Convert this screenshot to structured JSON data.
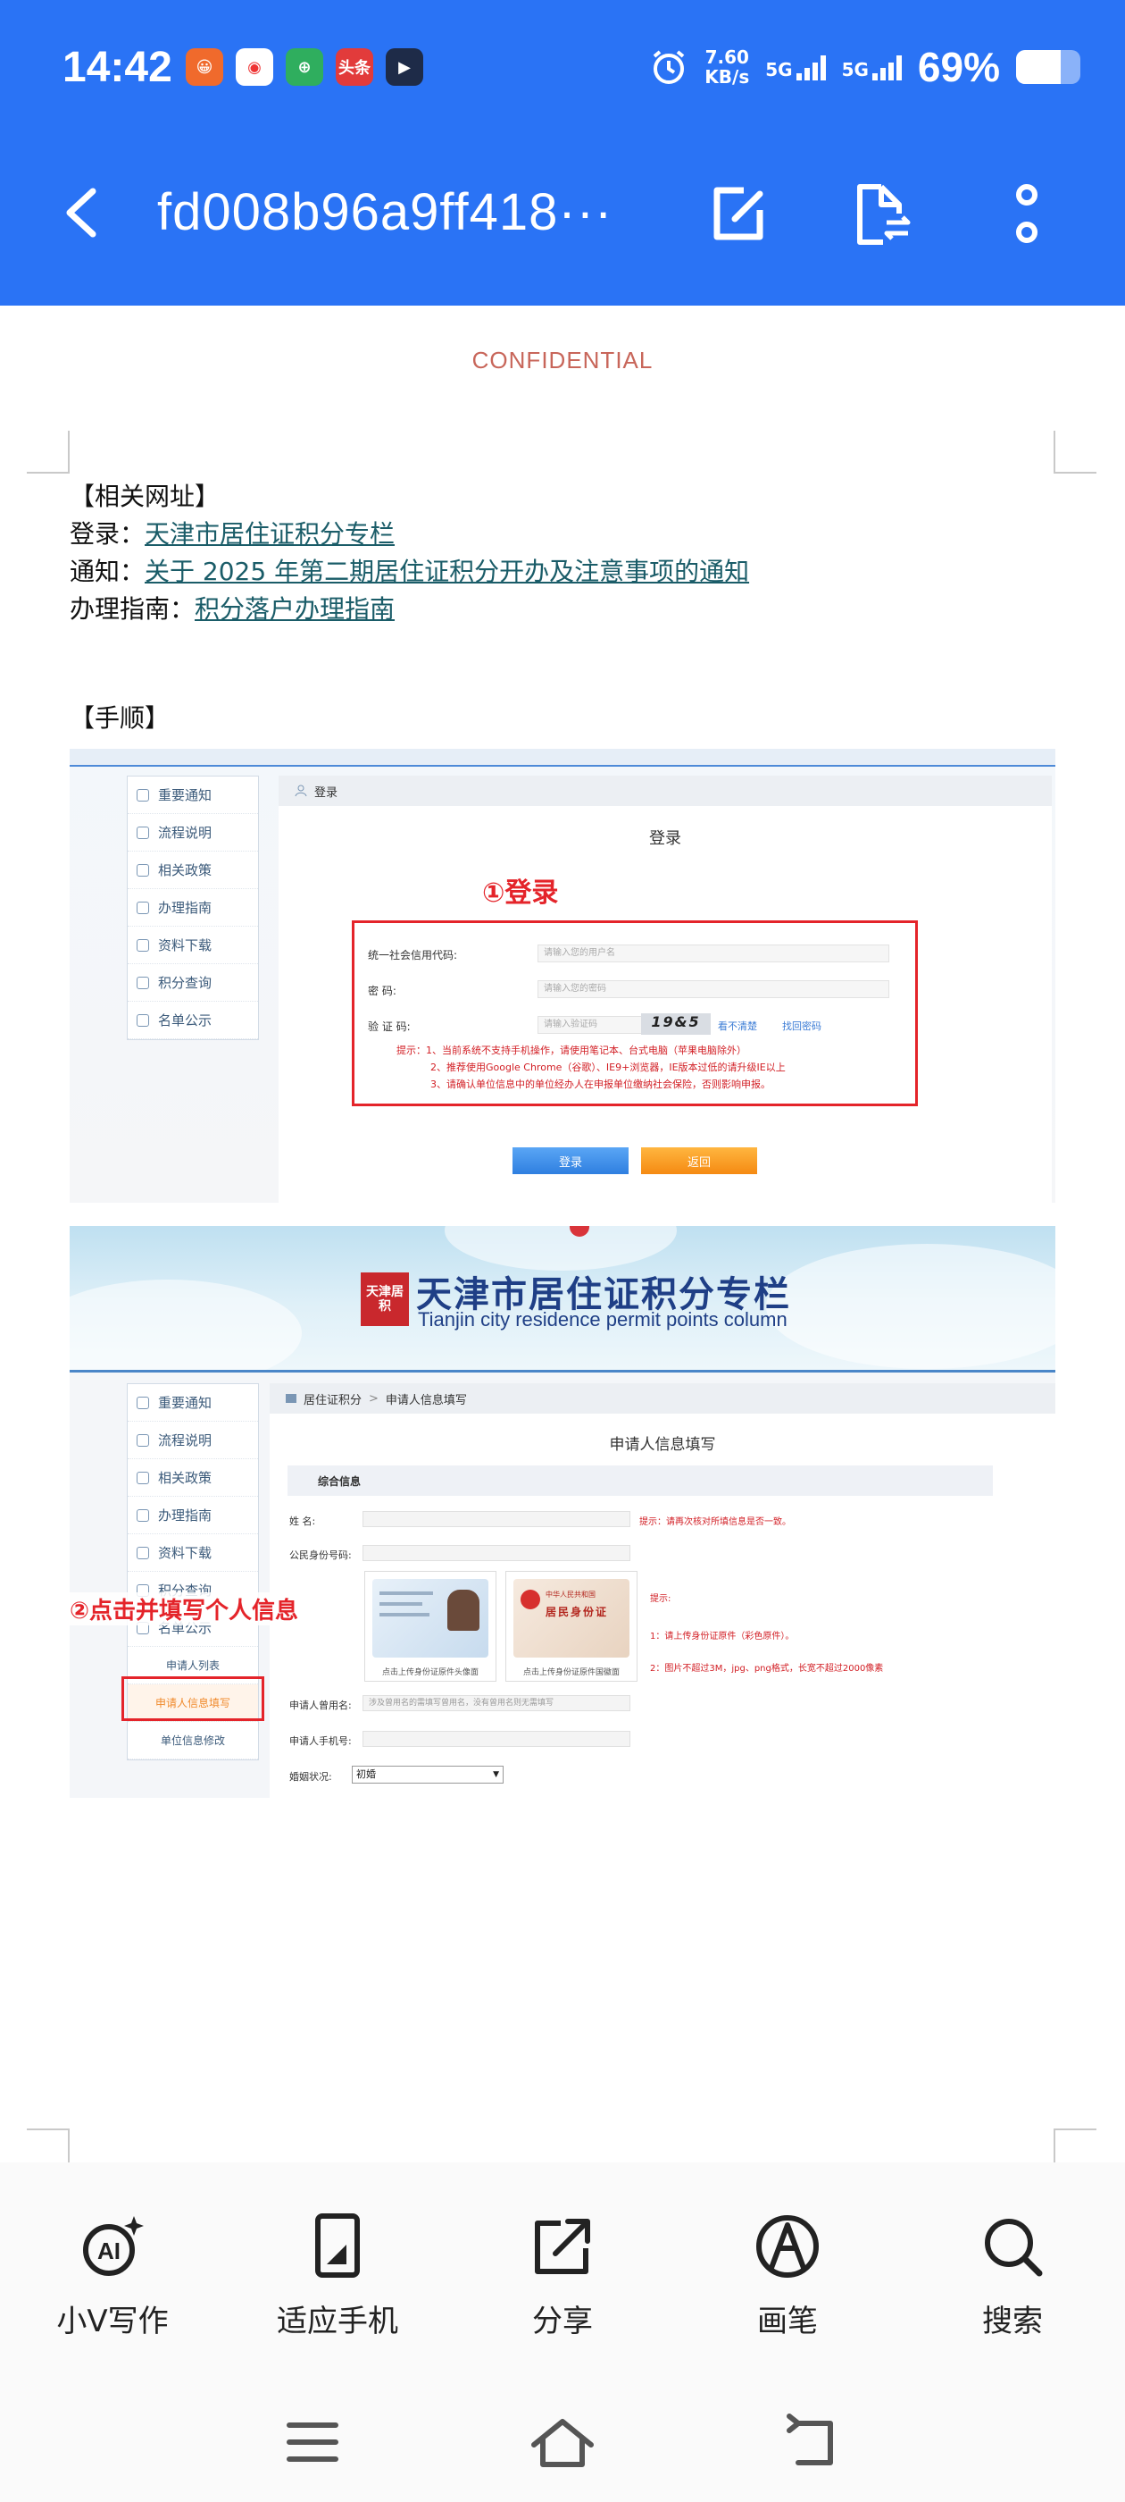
{
  "status_bar": {
    "time": "14:42",
    "apps": [
      {
        "name": "app-icon-1",
        "color": "#f06a2c",
        "glyph": "😀"
      },
      {
        "name": "app-icon-2",
        "color": "#ffffff",
        "glyph": "◉"
      },
      {
        "name": "app-icon-3",
        "color": "#2fae5e",
        "glyph": "⊕"
      },
      {
        "name": "toutiao-icon",
        "color": "#e23b3b",
        "glyph": "头条"
      },
      {
        "name": "app-icon-5",
        "color": "#1e2b48",
        "glyph": "▶"
      }
    ],
    "speed_value": "7.60",
    "speed_unit": "KB/s",
    "net1": "5G",
    "net2": "5G",
    "battery": "69%",
    "battery_level": 0.69
  },
  "nav": {
    "title": "fd008b96a9ff418···"
  },
  "doc": {
    "watermark": "CONFIDENTIAL",
    "links_heading": "【相关网址】",
    "line1_label": "登录：",
    "line1_link": "天津市居住证积分专栏",
    "line2_label": "通知：",
    "line2_link": "关于 2025 年第二期居住证积分开办及注意事项的通知",
    "line3_label": "办理指南：",
    "line3_link": "积分落户办理指南",
    "steps_heading": "【手顺】"
  },
  "shot1": {
    "menu": [
      "重要通知",
      "流程说明",
      "相关政策",
      "办理指南",
      "资料下载",
      "积分查询",
      "名单公示"
    ],
    "crumb": "登录",
    "panel_title": "登录",
    "annotation": "①登录",
    "fields": [
      {
        "label": "统一社会信用代码:",
        "placeholder": "请输入您的用户名"
      },
      {
        "label": "密      码:",
        "placeholder": "请输入您的密码"
      },
      {
        "label": "验  证  码:",
        "placeholder": "请输入验证码"
      }
    ],
    "captcha": "19&5",
    "captcha_link": "看不清楚",
    "forgot_link": "找回密码",
    "tips": [
      "提示：1、当前系统不支持手机操作，请使用笔记本、台式电脑（苹果电脑除外）",
      "2、推荐使用Google Chrome（谷歌）、IE9+浏览器，IE版本过低的请升级IE以上",
      "3、请确认单位信息中的单位经办人在申报单位缴纳社会保险，否则影响申报。"
    ],
    "btn_login": "登录",
    "btn_back": "返回"
  },
  "shot2": {
    "seal_text": "天津居积",
    "banner_cn": "天津市居住证积分专栏",
    "banner_en": "Tianjin city residence permit points column",
    "menu": [
      "重要通知",
      "流程说明",
      "相关政策",
      "办理指南",
      "资料下载",
      "积分查询",
      "名单公示"
    ],
    "submenu": [
      "申请人列表",
      "申请人信息填写",
      "单位信息修改"
    ],
    "crumb_home": "居住证积分",
    "crumb_sep": ">",
    "crumb_page": "申请人信息填写",
    "panel_title": "申请人信息填写",
    "section_title": "综合信息",
    "annotation": "②点击并填写个人信息",
    "name_label": "姓    名:",
    "name_tip": "提示：请再次核对所填信息是否一致。",
    "id_label": "公民身份号码:",
    "card1_caption": "点击上传身份证原件头像面",
    "card2_caption": "点击上传身份证原件国徽面",
    "card2_title": "中华人民共和国",
    "card2_subtitle": "居民身份证",
    "upload_tip_title": "提示:",
    "upload_tip1": "1：请上传身份证原件（彩色原件）。",
    "upload_tip2": "2：图片不超过3M，jpg、png格式，长宽不超过2000像素",
    "used_name_label": "申请人曾用名:",
    "used_name_placeholder": "涉及曾用名的需填写曾用名，没有曾用名则无需填写",
    "phone_label": "申请人手机号:",
    "marital_label": "婚姻状况:",
    "marital_value": "初婚"
  },
  "toolbar": {
    "items": [
      "小V写作",
      "适应手机",
      "分享",
      "画笔",
      "搜索"
    ]
  }
}
